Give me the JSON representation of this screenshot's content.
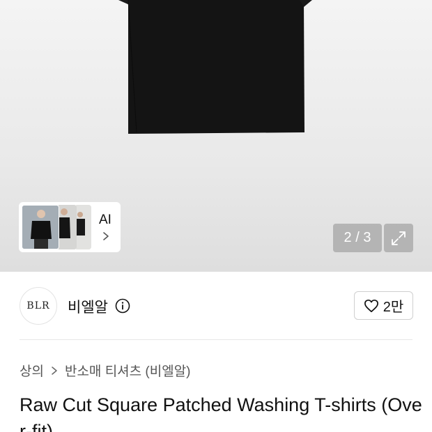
{
  "gallery": {
    "ai_label": "AI",
    "pager": "2 / 3",
    "icons": {
      "ai_chevron": "chevron-right-icon",
      "expand": "expand-icon"
    }
  },
  "brand": {
    "logo_text": "BLR",
    "name": "비엘알",
    "info_icon": "info-icon"
  },
  "like": {
    "icon": "heart-icon",
    "count": "2만"
  },
  "breadcrumb": {
    "items": [
      "상의",
      "반소매 티셔츠 (비엘알)"
    ]
  },
  "product": {
    "title": "Raw Cut Square Patched Washing T-shirts (Over-fit)"
  }
}
